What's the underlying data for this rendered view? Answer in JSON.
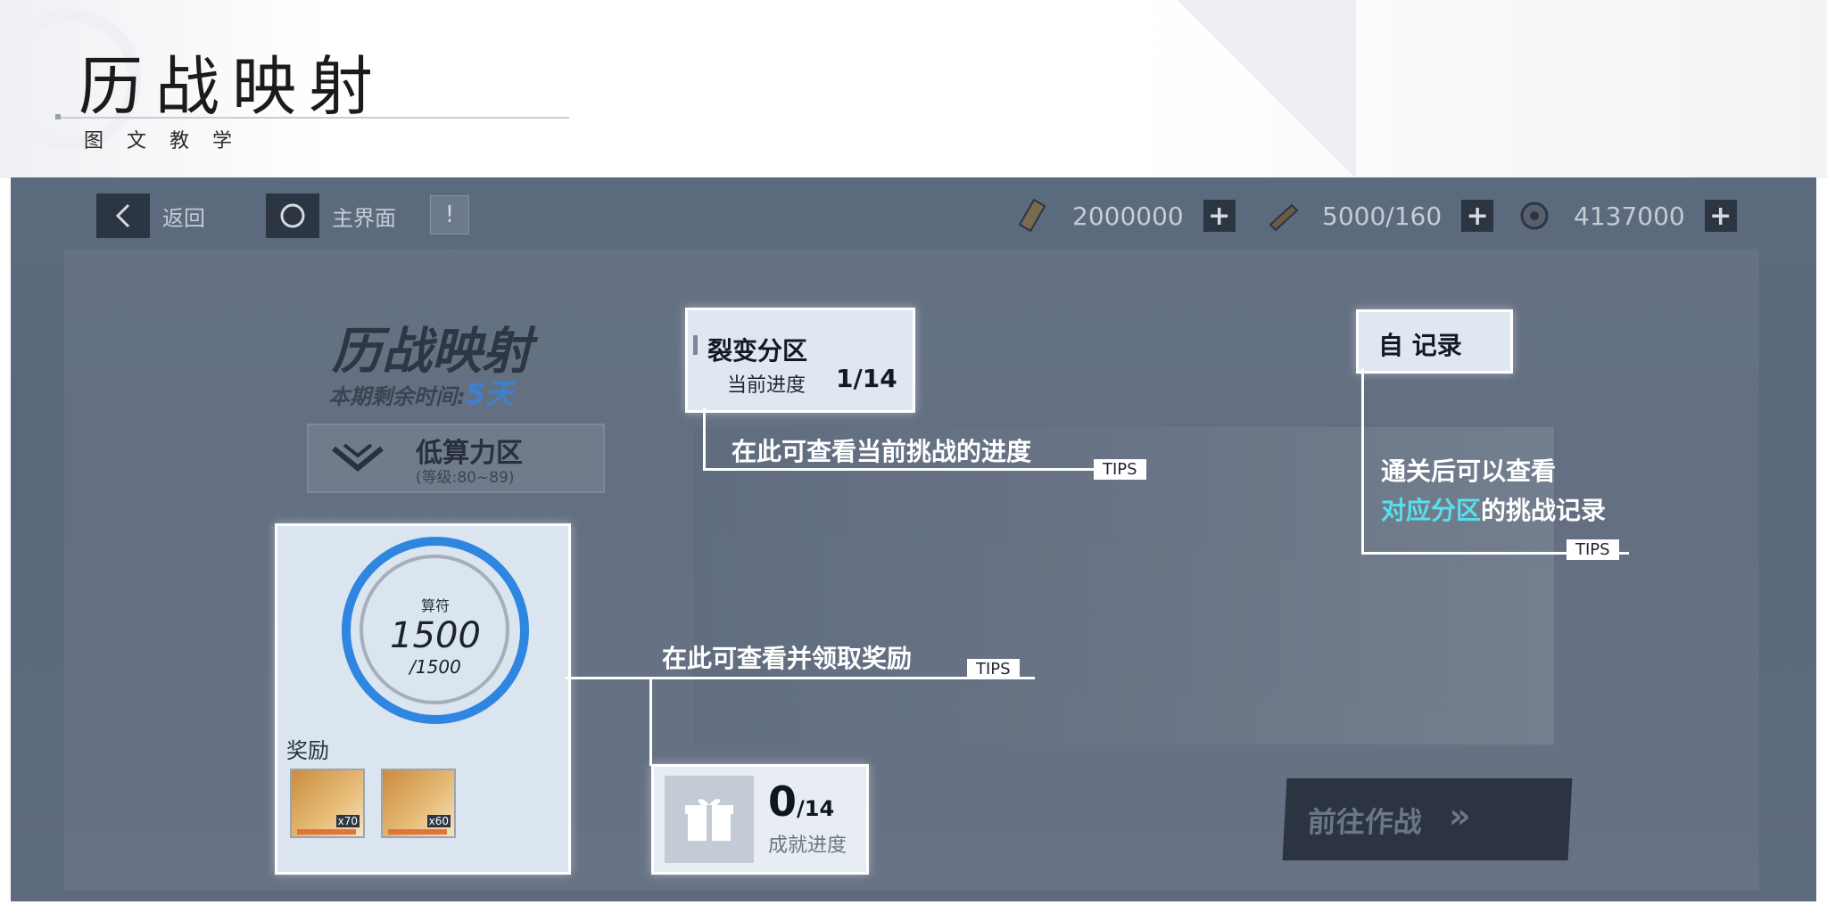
{
  "slide": {
    "title": "历战映射",
    "subtitle": "图文教学"
  },
  "topbar": {
    "back_label": "返回",
    "home_label": "主界面",
    "alert_symbol": "!",
    "resources": [
      {
        "icon": "ticket-icon",
        "value": "2000000"
      },
      {
        "icon": "blade-icon",
        "value": "5000/160"
      },
      {
        "icon": "gear-coin-icon",
        "value": "4137000"
      }
    ],
    "plus_symbol": "+"
  },
  "event": {
    "title": "历战映射",
    "remaining_label": "本期剩余时间:",
    "remaining_value": "5天",
    "zone_name": "低算力区",
    "zone_level": "(等级:80~89)"
  },
  "fission": {
    "title": "裂变分区",
    "progress_label": "当前进度",
    "progress_value": "1/14"
  },
  "record": {
    "title": "自 记录"
  },
  "reward_panel": {
    "currency_label": "算符",
    "current": "1500",
    "total": "/1500",
    "rewards_label": "奖励",
    "items": [
      {
        "qty": "x70"
      },
      {
        "qty": "x60"
      }
    ]
  },
  "achievement": {
    "current": "0",
    "total": "/14",
    "label": "成就进度"
  },
  "tips": {
    "progress_tip": "在此可查看当前挑战的进度",
    "reward_tip": "在此可查看并领取奖励",
    "record_tip_line1": "通关后可以查看",
    "record_tip_highlight": "对应分区",
    "record_tip_line2_rest": "的挑战记录",
    "tag": "TIPS"
  },
  "battle_button": {
    "label": "前往作战",
    "arrow": "»"
  }
}
